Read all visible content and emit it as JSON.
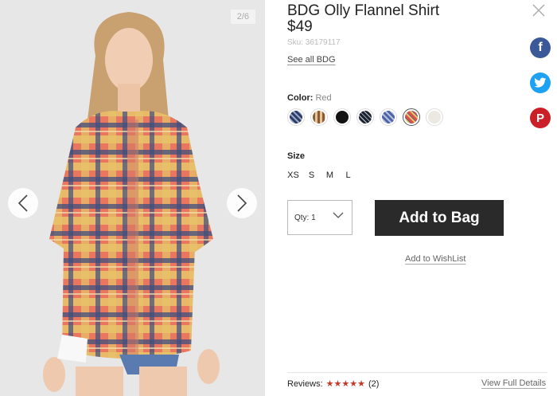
{
  "gallery": {
    "counter": "2/6",
    "prev_icon": "chevron-left-icon",
    "next_icon": "chevron-right-icon"
  },
  "product": {
    "title": "BDG Olly Flannel Shirt",
    "price": "$49",
    "sku": "Sku: 36179117",
    "see_all": "See all BDG"
  },
  "color": {
    "label": "Color:",
    "selected": "Red",
    "swatches": [
      {
        "name": "navy-plaid",
        "color": "#4a5a82",
        "selected": false
      },
      {
        "name": "tan-plaid",
        "color": "#b07a4c",
        "selected": false
      },
      {
        "name": "black",
        "color": "#111111",
        "selected": false
      },
      {
        "name": "black-white-plaid",
        "color": "#2a3340",
        "selected": false
      },
      {
        "name": "blue-plaid",
        "color": "#6b80b8",
        "selected": false
      },
      {
        "name": "red",
        "color": "#d9534f",
        "selected": true
      },
      {
        "name": "cream",
        "color": "#ece8e2",
        "selected": false
      }
    ]
  },
  "size": {
    "label": "Size",
    "options": [
      "XS",
      "S",
      "M",
      "L"
    ]
  },
  "cart": {
    "qty_label": "Qty: 1",
    "add_to_bag": "Add to Bag",
    "wishlist": "Add to WishList"
  },
  "reviews": {
    "label": "Reviews:",
    "stars": "★★★★★",
    "count": "(2)",
    "view_full": "View Full Details"
  },
  "social": {
    "facebook": "f",
    "pinterest": "P"
  },
  "colors": {
    "facebook": "#3b5998",
    "twitter": "#1da1f2",
    "pinterest": "#cb2027",
    "star": "#c0392b",
    "button": "#2a2a2a"
  }
}
